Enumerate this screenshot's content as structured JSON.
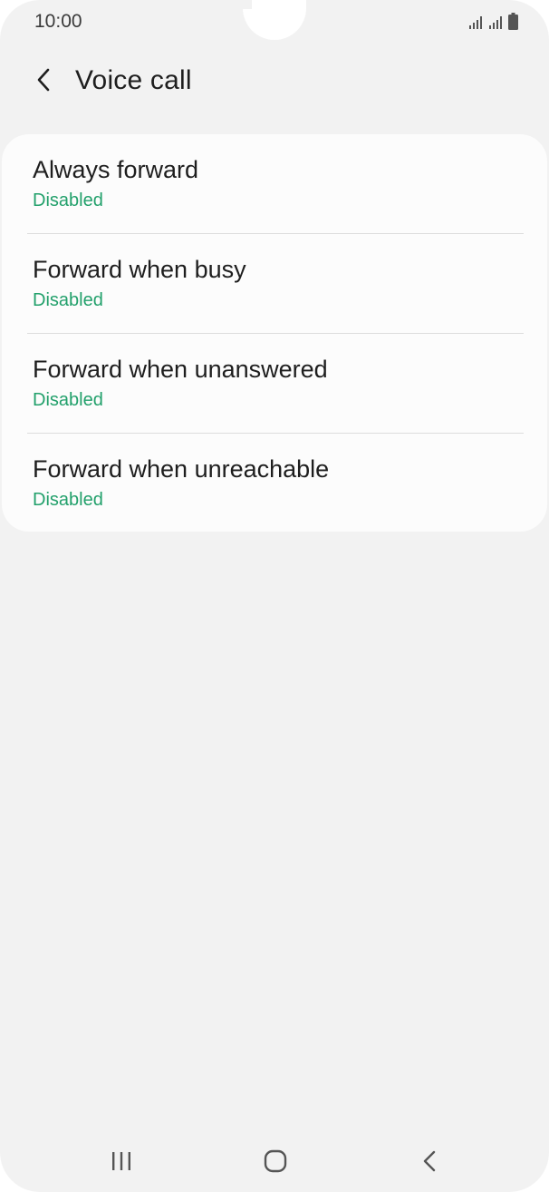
{
  "status_bar": {
    "time": "10:00"
  },
  "header": {
    "title": "Voice call",
    "back_icon": "chevron-left-icon"
  },
  "items": [
    {
      "title": "Always forward",
      "status": "Disabled"
    },
    {
      "title": "Forward when busy",
      "status": "Disabled"
    },
    {
      "title": "Forward when unanswered",
      "status": "Disabled"
    },
    {
      "title": "Forward when unreachable",
      "status": "Disabled"
    }
  ],
  "nav_bar": {
    "recents_icon": "recents-icon",
    "home_icon": "home-icon",
    "back_icon": "back-icon"
  },
  "colors": {
    "background": "#f2f2f2",
    "card": "#fcfcfc",
    "status_accent": "#22a06b",
    "text": "#1e1e1e"
  }
}
